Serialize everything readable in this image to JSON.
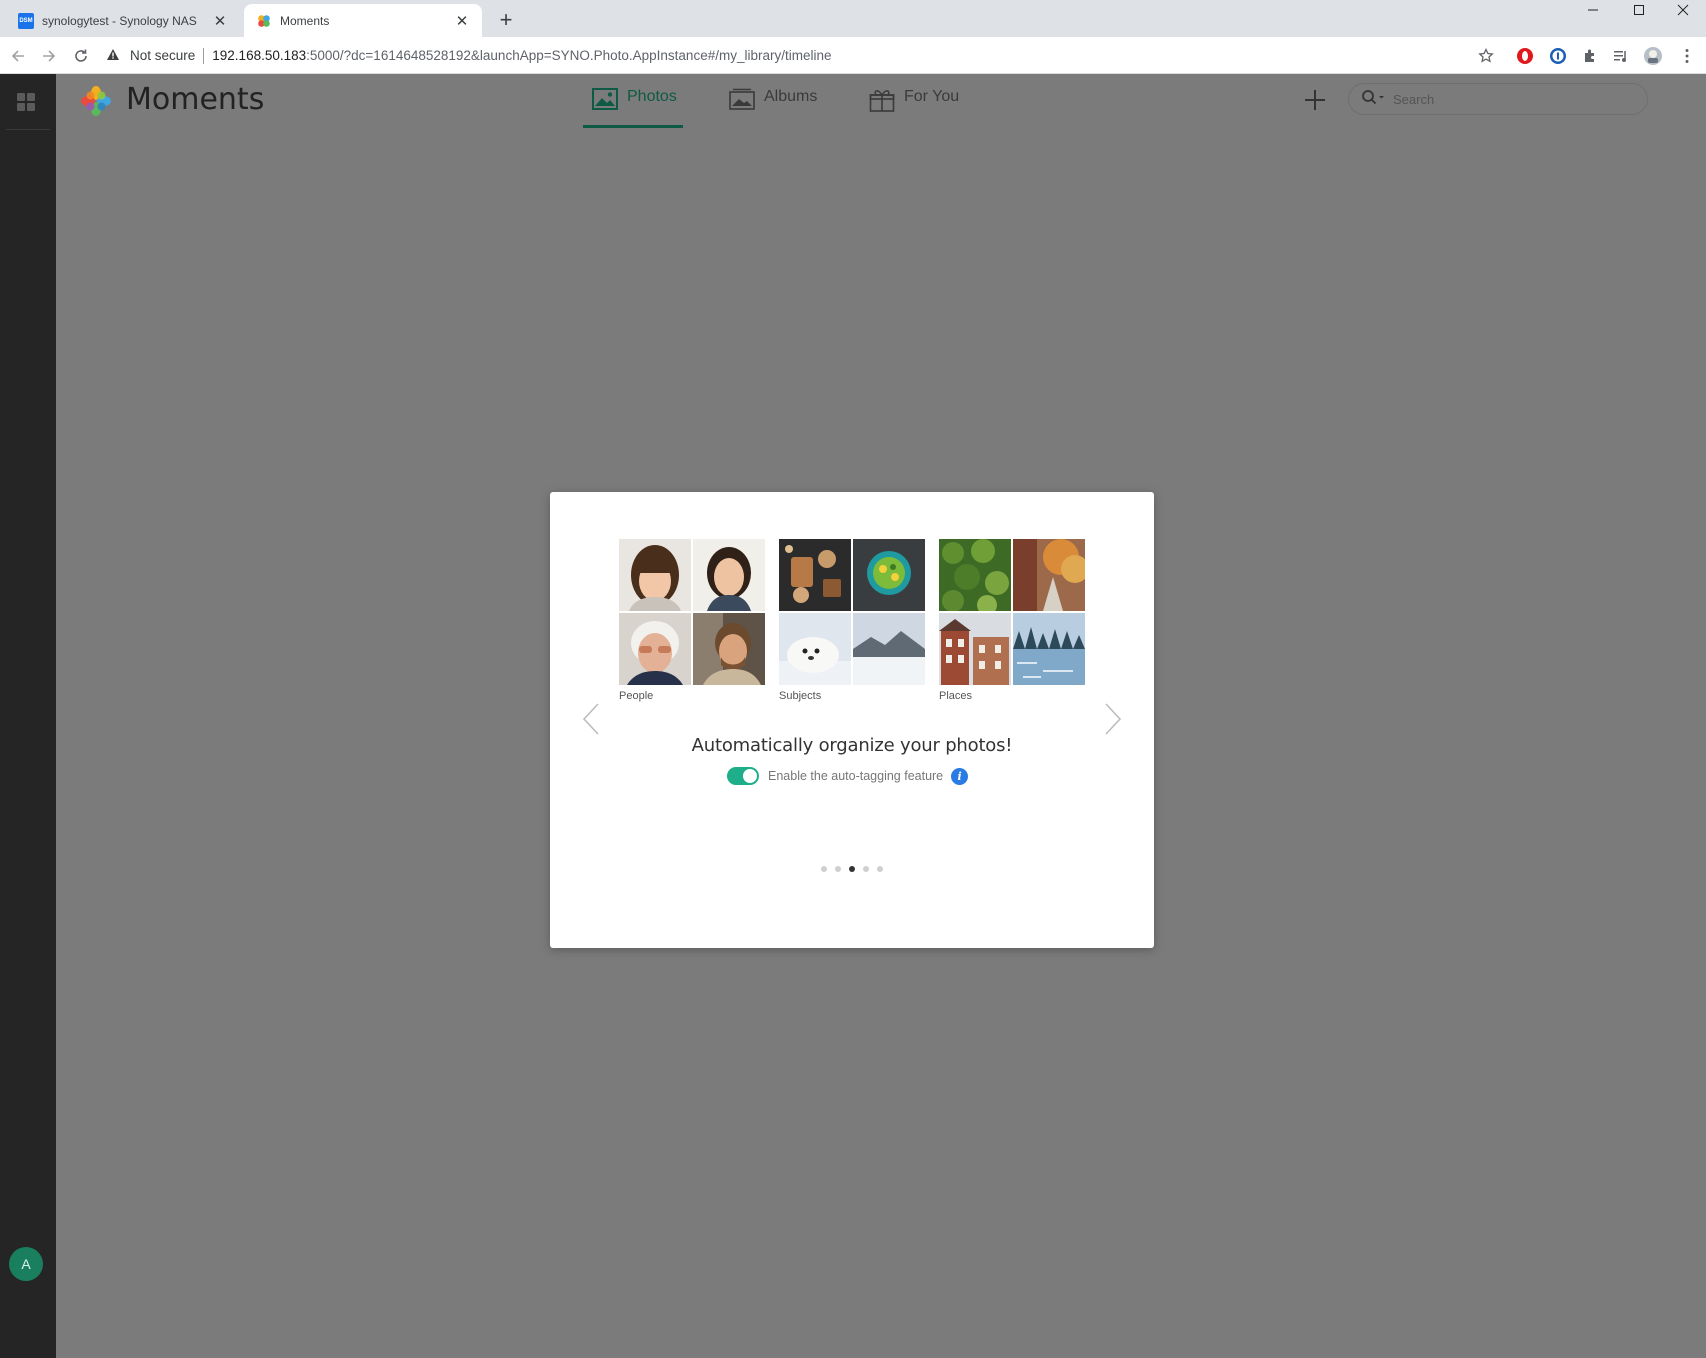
{
  "browser": {
    "tabs": [
      {
        "title": "synologytest - Synology NAS",
        "favicon": "DSM"
      },
      {
        "title": "Moments"
      }
    ],
    "address": {
      "security": "Not secure",
      "host": "192.168.50.183",
      "rest": ":5000/?dc=1614648528192&launchApp=SYNO.Photo.AppInstance#/my_library/timeline"
    }
  },
  "rail": {
    "avatar_initial": "A"
  },
  "app": {
    "title": "Moments",
    "nav": [
      {
        "label": "Photos",
        "icon": "photo-icon",
        "active": true
      },
      {
        "label": "Albums",
        "icon": "album-icon",
        "active": false
      },
      {
        "label": "For You",
        "icon": "gift-icon",
        "active": false
      }
    ],
    "search_placeholder": "Search",
    "accent_color": "#0f5a44"
  },
  "modal": {
    "groups": [
      {
        "label": "People"
      },
      {
        "label": "Subjects"
      },
      {
        "label": "Places"
      }
    ],
    "headline": "Automatically organize your photos!",
    "toggle_label": "Enable the auto-tagging feature",
    "toggle_on": true,
    "toggle_color": "#1fae8a",
    "info_glyph": "i",
    "pages_total": 5,
    "page_current": 3
  }
}
